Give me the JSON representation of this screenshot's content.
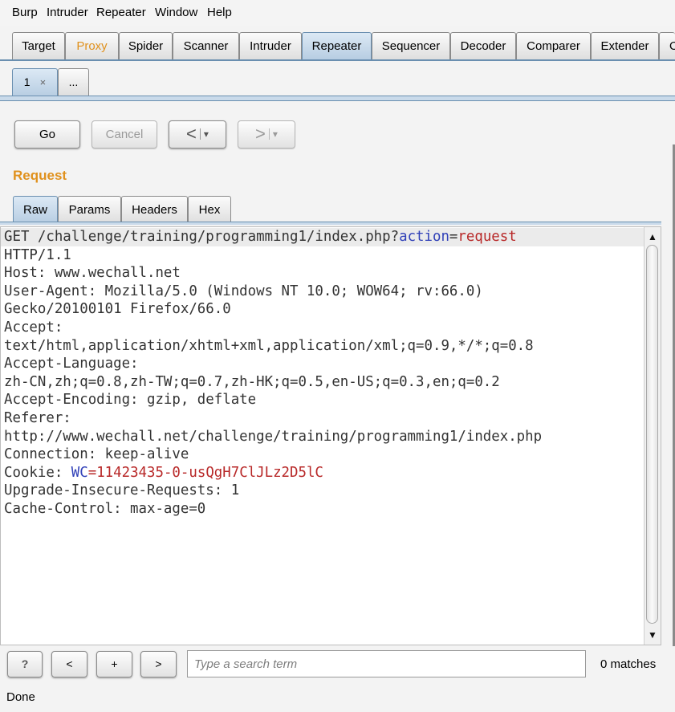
{
  "menu": [
    "Burp",
    "Intruder",
    "Repeater",
    "Window",
    "Help"
  ],
  "main_tabs": [
    "Target",
    "Proxy",
    "Spider",
    "Scanner",
    "Intruder",
    "Repeater",
    "Sequencer",
    "Decoder",
    "Comparer",
    "Extender",
    "O"
  ],
  "selected_main_tab": "Repeater",
  "sub_tabs": {
    "tab1": "1",
    "close": "×",
    "more": "..."
  },
  "toolbar": {
    "go": "Go",
    "cancel": "Cancel",
    "back": "<",
    "back_menu": "▾",
    "forward": ">",
    "forward_menu": "▾"
  },
  "request": {
    "title": "Request",
    "tabs": [
      "Raw",
      "Params",
      "Headers",
      "Hex"
    ],
    "line1": {
      "prefix": "GET /challenge/training/programming1/index.php?",
      "key": "action",
      "eq": "=",
      "val": "request"
    },
    "lines_a": [
      "HTTP/1.1",
      "Host: www.wechall.net",
      "User-Agent: Mozilla/5.0 (Windows NT 10.0; WOW64; rv:66.0)",
      "Gecko/20100101 Firefox/66.0",
      "Accept:",
      "text/html,application/xhtml+xml,application/xml;q=0.9,*/*;q=0.8",
      "Accept-Language:",
      "zh-CN,zh;q=0.8,zh-TW;q=0.7,zh-HK;q=0.5,en-US;q=0.3,en;q=0.2",
      "Accept-Encoding: gzip, deflate",
      "Referer:",
      "http://www.wechall.net/challenge/training/programming1/index.php",
      "Connection: keep-alive"
    ],
    "cookie_line": {
      "prefix": "Cookie: ",
      "key": "WC",
      "eq": "=",
      "val": "11423435-0-usQgH7ClJLz2D5lC"
    },
    "lines_b": [
      "Upgrade-Insecure-Requests: 1",
      "Cache-Control: max-age=0"
    ]
  },
  "search": {
    "help": "?",
    "prev": "<",
    "add": "+",
    "next": ">",
    "placeholder": "Type a search term",
    "matches": "0 matches"
  },
  "status": "Done",
  "colors": {
    "accent_orange": "#e0911d",
    "tab_selected": "#b7cde2",
    "param_name": "#3040b8",
    "param_value": "#b82828"
  }
}
